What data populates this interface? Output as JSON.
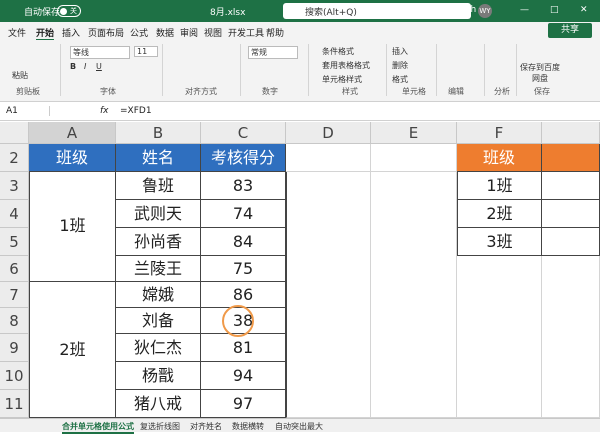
{
  "titlebar": {
    "autosave": "自动保存",
    "toggle": "关",
    "filename": "8月.xlsx",
    "search": "搜索(Alt+Q)",
    "user": "w yh",
    "avatar": "WY"
  },
  "tabs": [
    "文件",
    "开始",
    "插入",
    "页面布局",
    "公式",
    "数据",
    "审阅",
    "视图",
    "开发工具",
    "帮助"
  ],
  "share": "共享",
  "ribbon": {
    "groups": [
      "剪贴板",
      "字体",
      "对齐方式",
      "数字",
      "样式",
      "单元格",
      "编辑",
      "分析",
      "保存"
    ],
    "paste": "粘贴",
    "font": "等线",
    "size": "11",
    "format": "常规",
    "cf": "条件格式",
    "tbl": "套用表格格式",
    "cs": "单元格样式",
    "ins": "插入",
    "del": "删除",
    "fmt": "格式",
    "save": "保存到百度网盘"
  },
  "formula": {
    "namebox": "A1",
    "fx": "fx",
    "value": "=XFD1"
  },
  "columns": [
    "A",
    "B",
    "C",
    "D",
    "E",
    "F"
  ],
  "rows": [
    "2",
    "3",
    "4",
    "5",
    "6",
    "7",
    "8",
    "9",
    "10",
    "11"
  ],
  "table": {
    "h1": "班级",
    "h2": "姓名",
    "h3": "考核得分",
    "c1": "1班",
    "c2": "2班",
    "names": [
      "鲁班",
      "武则天",
      "孙尚香",
      "兰陵王",
      "嫦娥",
      "刘备",
      "狄仁杰",
      "杨戬",
      "猪八戒"
    ],
    "scores": [
      "83",
      "74",
      "84",
      "75",
      "86",
      "38",
      "81",
      "94",
      "97"
    ]
  },
  "lookup": {
    "header": "班级",
    "items": [
      "1班",
      "2班",
      "3班"
    ]
  },
  "sheets": [
    "合并单元格使用公式",
    "复选折线图",
    "对齐姓名",
    "数据横转",
    "自动突出最大"
  ]
}
